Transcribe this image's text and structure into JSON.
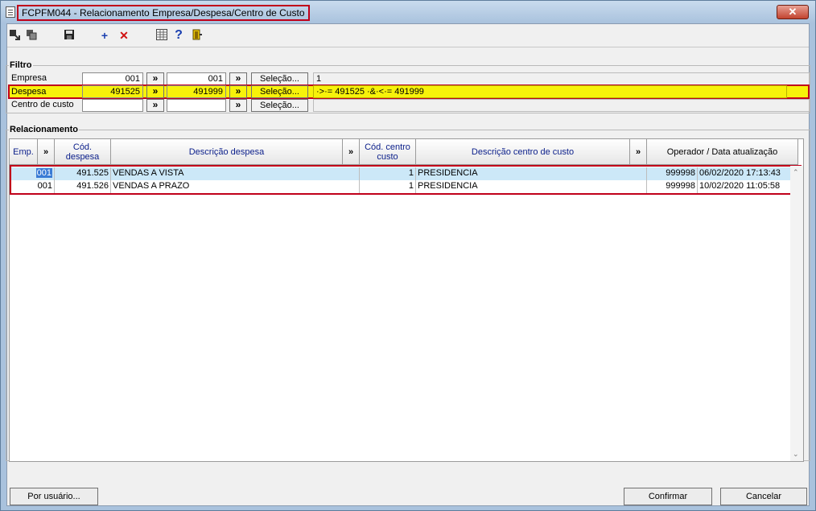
{
  "window": {
    "title": "FCPFM044 - Relacionamento Empresa/Despesa/Centro de Custo",
    "close_glyph": "✕"
  },
  "filtro": {
    "title": "Filtro",
    "rows": [
      {
        "label": "Empresa",
        "from": "001",
        "to": "001",
        "readout": "1"
      },
      {
        "label": "Despesa",
        "from": "491525",
        "to": "491999",
        "readout": "·>·= 491525 ·&·<·= 491999"
      },
      {
        "label": "Centro de custo",
        "from": "",
        "to": "",
        "readout": ""
      }
    ],
    "double_arrow": "»",
    "selecao_label": "Seleção..."
  },
  "relacionamento": {
    "title": "Relacionamento",
    "columns": {
      "emp": "Emp.",
      "cod_despesa": "Cód. despesa",
      "desc_despesa": "Descrição despesa",
      "cod_centro": "Cód. centro custo",
      "desc_centro": "Descrição centro de custo",
      "operador": "Operador / Data atualização"
    },
    "rows": [
      {
        "emp": "001",
        "cod_despesa": "491.525",
        "desc_despesa": "VENDAS A VISTA",
        "cod_centro": "1",
        "desc_centro": "PRESIDENCIA",
        "operador": "999998",
        "data": "06/02/2020 17:13:43"
      },
      {
        "emp": "001",
        "cod_despesa": "491.526",
        "desc_despesa": "VENDAS A PRAZO",
        "cod_centro": "1",
        "desc_centro": "PRESIDENCIA",
        "operador": "999998",
        "data": "10/02/2020 11:05:58"
      }
    ]
  },
  "footer": {
    "por_usuario": "Por usuário...",
    "confirmar": "Confirmar",
    "cancelar": "Cancelar"
  },
  "icons": [
    "select-icon",
    "copy-icon",
    "save-icon",
    "add-icon",
    "delete-icon",
    "grid-icon",
    "help-icon",
    "exit-icon"
  ],
  "colors": {
    "highlight_yellow": "#f7f20a",
    "annotation_red": "#c0001a",
    "selected_row": "#cce8f8",
    "header_text": "#0a1e8a"
  }
}
